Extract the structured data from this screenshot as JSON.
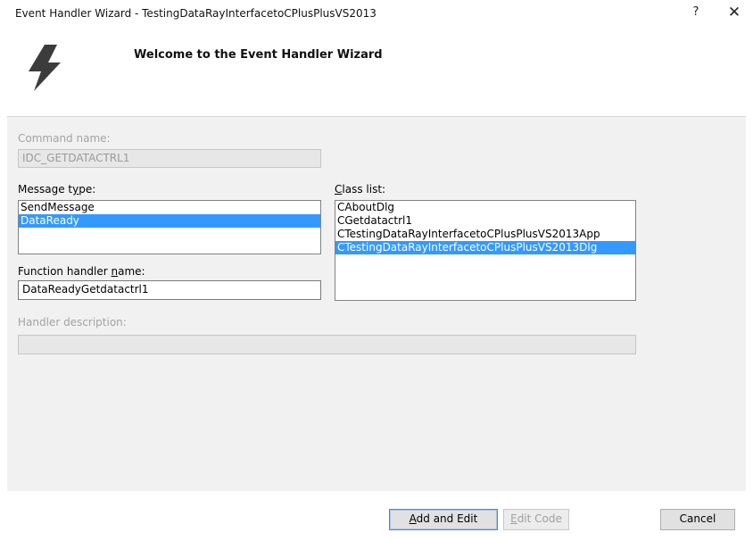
{
  "window": {
    "title": "Event Handler Wizard - TestingDataRayInterfacetoCPlusPlusVS2013",
    "help_glyph": "?",
    "close_glyph": "✕"
  },
  "header": {
    "icon": "lightning-bolt-icon",
    "title": "Welcome to the Event Handler Wizard"
  },
  "command_name": {
    "label": "Command name:",
    "value": "IDC_GETDATACTRL1"
  },
  "message_type": {
    "label_pre": "Message t",
    "label_key": "y",
    "label_post": "pe:",
    "items": [
      "SendMessage",
      "DataReady"
    ],
    "selected": "DataReady"
  },
  "class_list": {
    "label_key": "C",
    "label_post": "lass list:",
    "items": [
      "CAboutDlg",
      "CGetdatactrl1",
      "CTestingDataRayInterfacetoCPlusPlusVS2013App",
      "CTestingDataRayInterfacetoCPlusPlusVS2013Dlg"
    ],
    "selected": "CTestingDataRayInterfacetoCPlusPlusVS2013Dlg"
  },
  "function_handler": {
    "label_pre": "Function handler ",
    "label_key": "n",
    "label_post": "ame:",
    "value": "DataReadyGetdatactrl1"
  },
  "handler_description": {
    "label": "Handler description:",
    "value": ""
  },
  "buttons": {
    "add_and_edit_key": "A",
    "add_and_edit_rest": "dd and Edit",
    "edit_code_key": "E",
    "edit_code_rest": "dit Code",
    "cancel": "Cancel"
  },
  "colors": {
    "selection": "#3399ff",
    "panel_background": "#f1f1f1"
  }
}
